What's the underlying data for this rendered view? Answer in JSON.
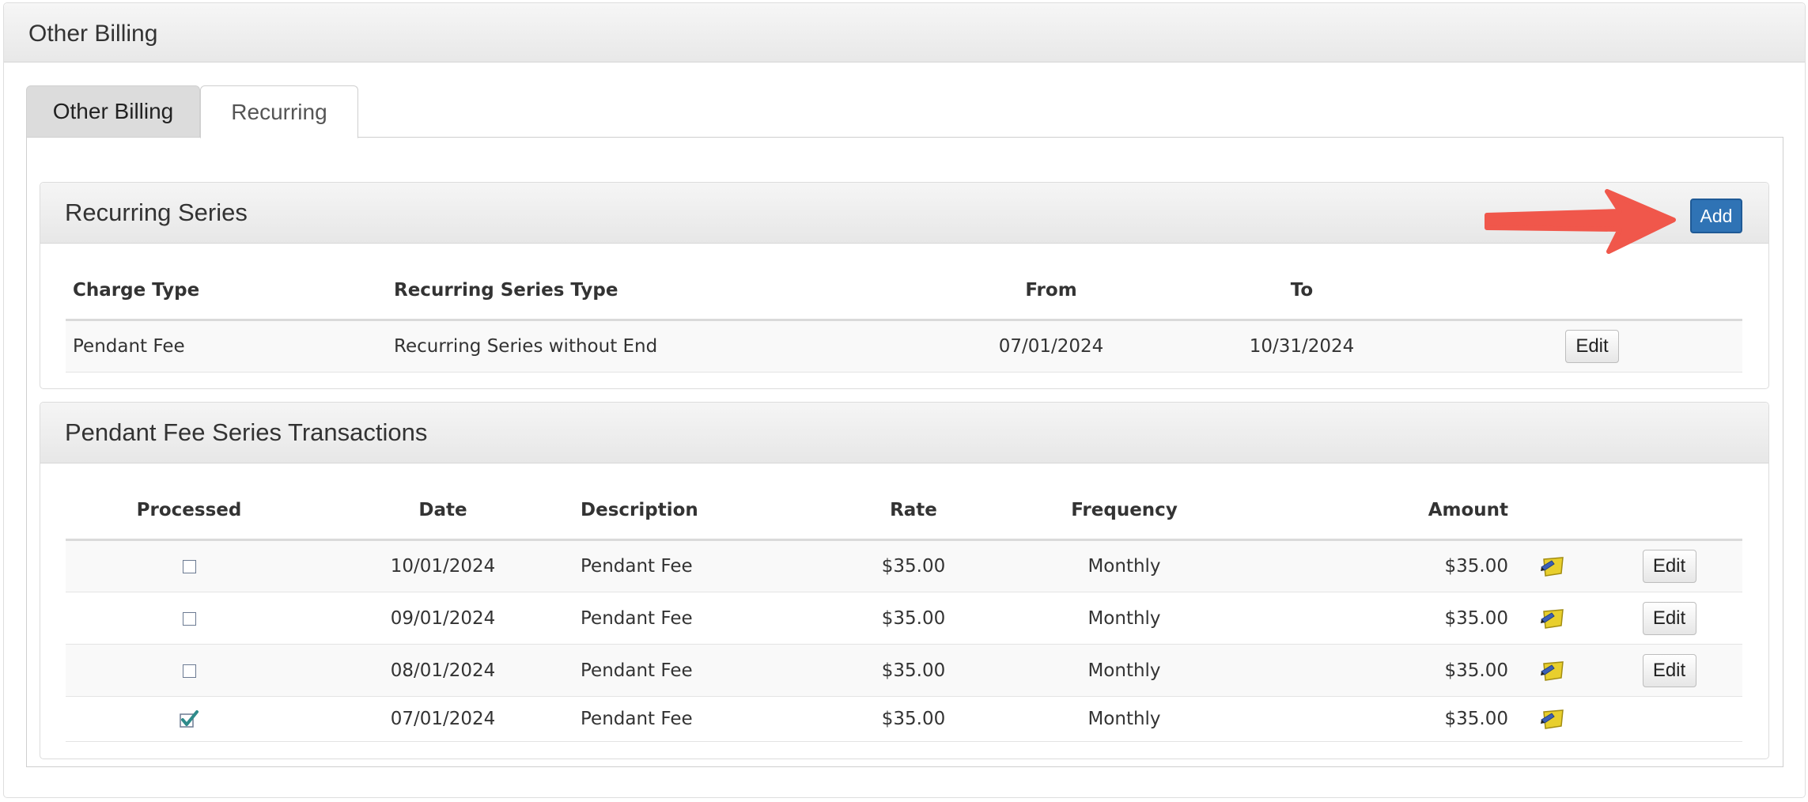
{
  "page": {
    "title": "Other Billing"
  },
  "tabs": [
    {
      "label": "Other Billing",
      "active": false
    },
    {
      "label": "Recurring",
      "active": true
    }
  ],
  "recurring_series": {
    "title": "Recurring Series",
    "add_label": "Add",
    "columns": [
      "Charge Type",
      "Recurring Series Type",
      "From",
      "To"
    ],
    "rows": [
      {
        "charge_type": "Pendant Fee",
        "series_type": "Recurring Series without End",
        "from": "07/01/2024",
        "to": "10/31/2024",
        "edit_label": "Edit"
      }
    ]
  },
  "transactions": {
    "title": "Pendant Fee Series Transactions",
    "columns": [
      "Processed",
      "Date",
      "Description",
      "Rate",
      "Frequency",
      "Amount"
    ],
    "rows": [
      {
        "processed": false,
        "date": "10/01/2024",
        "description": "Pendant Fee",
        "rate": "$35.00",
        "frequency": "Monthly",
        "amount": "$35.00",
        "edit_label": "Edit",
        "note_icon": "note-pencil-icon"
      },
      {
        "processed": false,
        "date": "09/01/2024",
        "description": "Pendant Fee",
        "rate": "$35.00",
        "frequency": "Monthly",
        "amount": "$35.00",
        "edit_label": "Edit",
        "note_icon": "note-pencil-icon"
      },
      {
        "processed": false,
        "date": "08/01/2024",
        "description": "Pendant Fee",
        "rate": "$35.00",
        "frequency": "Monthly",
        "amount": "$35.00",
        "edit_label": "Edit",
        "note_icon": "note-pencil-icon"
      },
      {
        "processed": true,
        "date": "07/01/2024",
        "description": "Pendant Fee",
        "rate": "$35.00",
        "frequency": "Monthly",
        "amount": "$35.00",
        "edit_label": "",
        "note_icon": "note-pencil-icon"
      }
    ]
  },
  "colors": {
    "accent": "#2f73b5",
    "annotation_arrow": "#f0574b",
    "icon_note": "#e8cf2d"
  }
}
